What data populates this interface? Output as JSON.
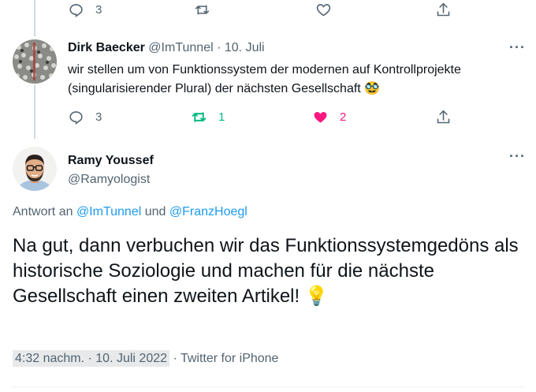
{
  "top_tweet": {
    "reply_count": "3"
  },
  "dirk_tweet": {
    "name": "Dirk Baecker",
    "handle": "@ImTunnel",
    "separator": "·",
    "date": "10. Juli",
    "more": "···",
    "text": "wir stellen um von Funktionssystem der modernen auf Kontrollprojekte (singularisierender Plural) der nächsten Gesellschaft",
    "emoji": "🥸",
    "reply_count": "3",
    "retweet_count": "1",
    "like_count": "2",
    "colors": {
      "retweet_active": "#00ba7c",
      "like_active": "#f91880"
    }
  },
  "main_tweet": {
    "name": "Ramy Youssef",
    "handle": "@Ramyologist",
    "more": "···",
    "reply_prefix": "Antwort an",
    "reply_user1": "@ImTunnel",
    "reply_and": "und",
    "reply_user2": "@FranzHoegl",
    "text": "Na gut, dann verbuchen wir das Funktionssystemgedöns als historische Soziologie und machen für die nächste Gesellschaft einen zweiten Artikel!",
    "emoji": "💡",
    "time": "4:32 nachm. · 10. Juli 2022",
    "separator": "·",
    "source": "Twitter for iPhone"
  },
  "icons": [
    "reply-icon",
    "retweet-icon",
    "like-icon",
    "share-icon",
    "more-icon"
  ],
  "colors": {
    "link": "#1d9bf0",
    "secondary": "#536471",
    "thread_line": "#cfd9de"
  }
}
